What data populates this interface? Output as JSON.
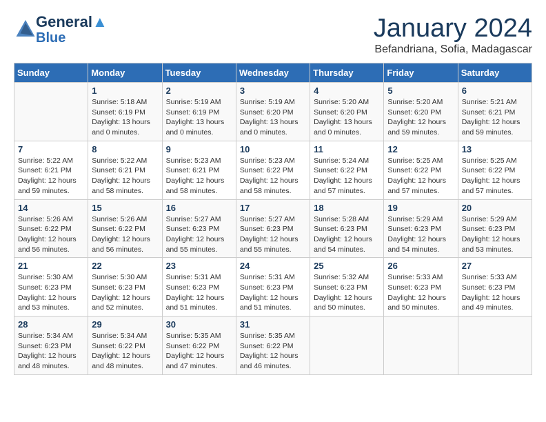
{
  "header": {
    "logo_line1": "General",
    "logo_line2": "Blue",
    "month": "January 2024",
    "location": "Befandriana, Sofia, Madagascar"
  },
  "weekdays": [
    "Sunday",
    "Monday",
    "Tuesday",
    "Wednesday",
    "Thursday",
    "Friday",
    "Saturday"
  ],
  "rows": [
    [
      {
        "day": "",
        "info": ""
      },
      {
        "day": "1",
        "info": "Sunrise: 5:18 AM\nSunset: 6:19 PM\nDaylight: 13 hours\nand 0 minutes."
      },
      {
        "day": "2",
        "info": "Sunrise: 5:19 AM\nSunset: 6:19 PM\nDaylight: 13 hours\nand 0 minutes."
      },
      {
        "day": "3",
        "info": "Sunrise: 5:19 AM\nSunset: 6:20 PM\nDaylight: 13 hours\nand 0 minutes."
      },
      {
        "day": "4",
        "info": "Sunrise: 5:20 AM\nSunset: 6:20 PM\nDaylight: 13 hours\nand 0 minutes."
      },
      {
        "day": "5",
        "info": "Sunrise: 5:20 AM\nSunset: 6:20 PM\nDaylight: 12 hours\nand 59 minutes."
      },
      {
        "day": "6",
        "info": "Sunrise: 5:21 AM\nSunset: 6:21 PM\nDaylight: 12 hours\nand 59 minutes."
      }
    ],
    [
      {
        "day": "7",
        "info": "Sunrise: 5:22 AM\nSunset: 6:21 PM\nDaylight: 12 hours\nand 59 minutes."
      },
      {
        "day": "8",
        "info": "Sunrise: 5:22 AM\nSunset: 6:21 PM\nDaylight: 12 hours\nand 58 minutes."
      },
      {
        "day": "9",
        "info": "Sunrise: 5:23 AM\nSunset: 6:21 PM\nDaylight: 12 hours\nand 58 minutes."
      },
      {
        "day": "10",
        "info": "Sunrise: 5:23 AM\nSunset: 6:22 PM\nDaylight: 12 hours\nand 58 minutes."
      },
      {
        "day": "11",
        "info": "Sunrise: 5:24 AM\nSunset: 6:22 PM\nDaylight: 12 hours\nand 57 minutes."
      },
      {
        "day": "12",
        "info": "Sunrise: 5:25 AM\nSunset: 6:22 PM\nDaylight: 12 hours\nand 57 minutes."
      },
      {
        "day": "13",
        "info": "Sunrise: 5:25 AM\nSunset: 6:22 PM\nDaylight: 12 hours\nand 57 minutes."
      }
    ],
    [
      {
        "day": "14",
        "info": "Sunrise: 5:26 AM\nSunset: 6:22 PM\nDaylight: 12 hours\nand 56 minutes."
      },
      {
        "day": "15",
        "info": "Sunrise: 5:26 AM\nSunset: 6:22 PM\nDaylight: 12 hours\nand 56 minutes."
      },
      {
        "day": "16",
        "info": "Sunrise: 5:27 AM\nSunset: 6:23 PM\nDaylight: 12 hours\nand 55 minutes."
      },
      {
        "day": "17",
        "info": "Sunrise: 5:27 AM\nSunset: 6:23 PM\nDaylight: 12 hours\nand 55 minutes."
      },
      {
        "day": "18",
        "info": "Sunrise: 5:28 AM\nSunset: 6:23 PM\nDaylight: 12 hours\nand 54 minutes."
      },
      {
        "day": "19",
        "info": "Sunrise: 5:29 AM\nSunset: 6:23 PM\nDaylight: 12 hours\nand 54 minutes."
      },
      {
        "day": "20",
        "info": "Sunrise: 5:29 AM\nSunset: 6:23 PM\nDaylight: 12 hours\nand 53 minutes."
      }
    ],
    [
      {
        "day": "21",
        "info": "Sunrise: 5:30 AM\nSunset: 6:23 PM\nDaylight: 12 hours\nand 53 minutes."
      },
      {
        "day": "22",
        "info": "Sunrise: 5:30 AM\nSunset: 6:23 PM\nDaylight: 12 hours\nand 52 minutes."
      },
      {
        "day": "23",
        "info": "Sunrise: 5:31 AM\nSunset: 6:23 PM\nDaylight: 12 hours\nand 51 minutes."
      },
      {
        "day": "24",
        "info": "Sunrise: 5:31 AM\nSunset: 6:23 PM\nDaylight: 12 hours\nand 51 minutes."
      },
      {
        "day": "25",
        "info": "Sunrise: 5:32 AM\nSunset: 6:23 PM\nDaylight: 12 hours\nand 50 minutes."
      },
      {
        "day": "26",
        "info": "Sunrise: 5:33 AM\nSunset: 6:23 PM\nDaylight: 12 hours\nand 50 minutes."
      },
      {
        "day": "27",
        "info": "Sunrise: 5:33 AM\nSunset: 6:23 PM\nDaylight: 12 hours\nand 49 minutes."
      }
    ],
    [
      {
        "day": "28",
        "info": "Sunrise: 5:34 AM\nSunset: 6:23 PM\nDaylight: 12 hours\nand 48 minutes."
      },
      {
        "day": "29",
        "info": "Sunrise: 5:34 AM\nSunset: 6:22 PM\nDaylight: 12 hours\nand 48 minutes."
      },
      {
        "day": "30",
        "info": "Sunrise: 5:35 AM\nSunset: 6:22 PM\nDaylight: 12 hours\nand 47 minutes."
      },
      {
        "day": "31",
        "info": "Sunrise: 5:35 AM\nSunset: 6:22 PM\nDaylight: 12 hours\nand 46 minutes."
      },
      {
        "day": "",
        "info": ""
      },
      {
        "day": "",
        "info": ""
      },
      {
        "day": "",
        "info": ""
      }
    ]
  ]
}
